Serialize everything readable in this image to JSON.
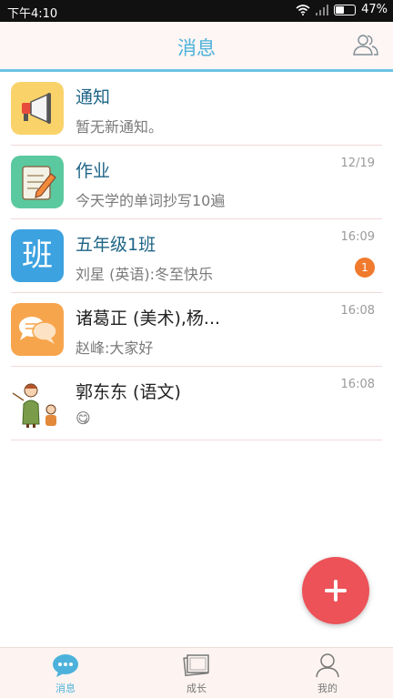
{
  "status_bar": {
    "time": "下午4:10",
    "battery": "47%"
  },
  "header": {
    "title": "消息"
  },
  "messages": [
    {
      "name": "通知",
      "preview": "暂无新通知。",
      "time": "",
      "badge": "",
      "icon": "megaphone-icon"
    },
    {
      "name": "作业",
      "preview": "今天学的单词抄写10遍",
      "time": "12/19",
      "badge": "",
      "icon": "notepad-pencil-icon"
    },
    {
      "name": "五年级1班",
      "preview": "刘星 (英语):冬至快乐",
      "time": "16:09",
      "badge": "1",
      "icon": "class-icon",
      "avatar_text": "班"
    },
    {
      "name": "诸葛正 (美术),杨...",
      "preview": "赵峰:大家好",
      "time": "16:08",
      "badge": "",
      "icon": "chat-bubbles-icon"
    },
    {
      "name": "郭东东 (语文)",
      "preview": "😋",
      "time": "16:08",
      "badge": "",
      "icon": "teacher-avatar"
    }
  ],
  "tabs": [
    {
      "label": "消息",
      "active": true,
      "icon": "message-icon"
    },
    {
      "label": "成长",
      "active": false,
      "icon": "photos-icon"
    },
    {
      "label": "我的",
      "active": false,
      "icon": "person-icon"
    }
  ],
  "colors": {
    "accent": "#4db2db",
    "fab": "#ec5258",
    "badge": "#f07a2d"
  }
}
